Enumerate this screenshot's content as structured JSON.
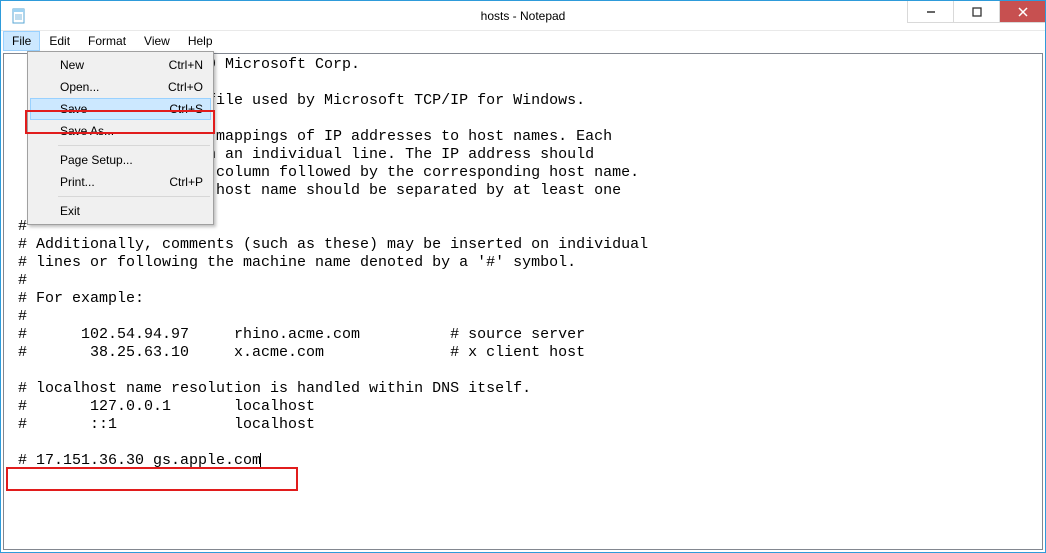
{
  "window": {
    "title": "hosts - Notepad"
  },
  "menubar": {
    "file": "File",
    "edit": "Edit",
    "format": "Format",
    "view": "View",
    "help": "Help"
  },
  "file_menu": {
    "new": {
      "label": "New",
      "shortcut": "Ctrl+N"
    },
    "open": {
      "label": "Open...",
      "shortcut": "Ctrl+O"
    },
    "save": {
      "label": "Save",
      "shortcut": "Ctrl+S"
    },
    "saveas": {
      "label": "Save As...",
      "shortcut": ""
    },
    "pagesetup": {
      "label": "Page Setup...",
      "shortcut": ""
    },
    "print": {
      "label": "Print...",
      "shortcut": "Ctrl+P"
    },
    "exit": {
      "label": "Exit",
      "shortcut": ""
    }
  },
  "content": {
    "line01": "                    09 Microsoft Corp.",
    "line02": "",
    "line03": "                     file used by Microsoft TCP/IP for Windows.",
    "line04": "",
    "line05": "                    e mappings of IP addresses to host names. Each",
    "line06": "                    on an individual line. The IP address should",
    "line07": "                    t column followed by the corresponding host name.",
    "line08": "                    e host name should be separated by at least one",
    "line09": "",
    "line10": "#",
    "line11": "# Additionally, comments (such as these) may be inserted on individual",
    "line12": "# lines or following the machine name denoted by a '#' symbol.",
    "line13": "#",
    "line14": "# For example:",
    "line15": "#",
    "line16": "#      102.54.94.97     rhino.acme.com          # source server",
    "line17": "#       38.25.63.10     x.acme.com              # x client host",
    "line18": "",
    "line19": "# localhost name resolution is handled within DNS itself.",
    "line20": "#       127.0.0.1       localhost",
    "line21": "#       ::1             localhost",
    "line22": "",
    "line23": "# 17.151.36.30 gs.apple.com"
  }
}
